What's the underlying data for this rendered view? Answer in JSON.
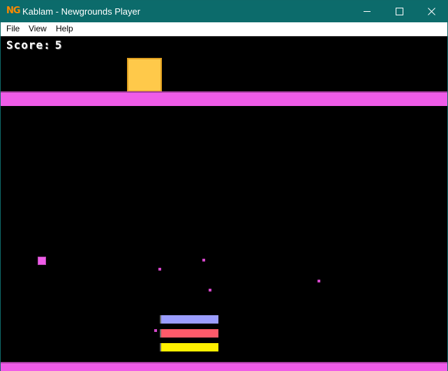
{
  "window": {
    "title": "Kablam - Newgrounds Player",
    "logo_text": "NG",
    "title_color": "#0c6b6b"
  },
  "menu": [
    "File",
    "View",
    "Help"
  ],
  "game": {
    "score_label": "Score:",
    "score_value": "5",
    "colors": {
      "background": "#000000",
      "platform": "#ef5ce8",
      "block": "#ffc94a",
      "bar_1": "#9b9dff",
      "bar_2": "#ff5a6a",
      "bar_3": "#fff000"
    }
  }
}
